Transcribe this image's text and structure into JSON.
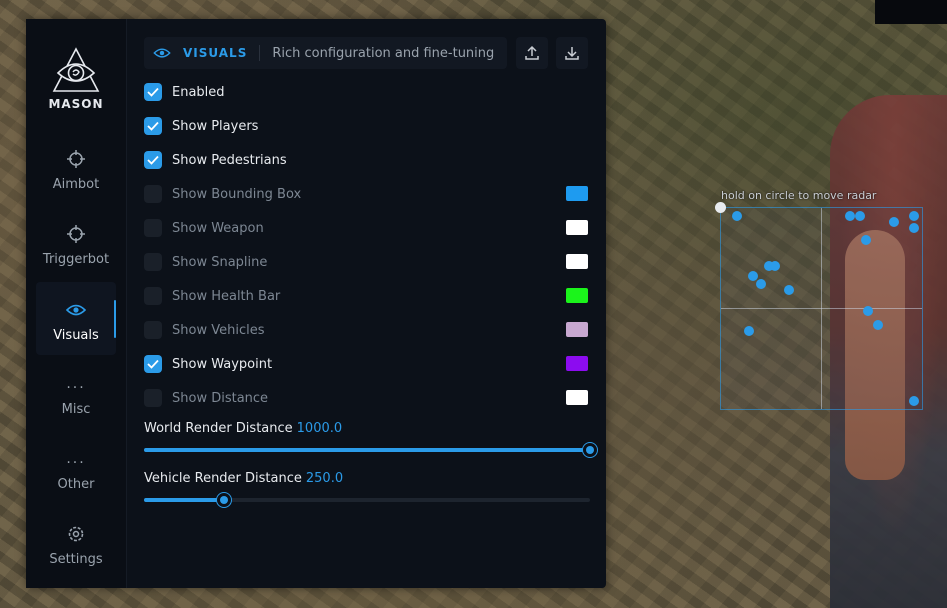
{
  "app": {
    "name": "MASON"
  },
  "nav": [
    {
      "label": "Aimbot",
      "icon": "crosshair-icon",
      "active": false
    },
    {
      "label": "Triggerbot",
      "icon": "crosshair-icon",
      "active": false
    },
    {
      "label": "Visuals",
      "icon": "eye-icon",
      "active": true
    },
    {
      "label": "Misc",
      "icon": "more-icon",
      "active": false
    },
    {
      "label": "Other",
      "icon": "more-icon",
      "active": false
    },
    {
      "label": "Settings",
      "icon": "gear-icon",
      "active": false
    }
  ],
  "header": {
    "title": "VISUALS",
    "subtitle": "Rich configuration and fine-tuning",
    "upload_icon": "upload-icon",
    "download_icon": "download-icon"
  },
  "options": [
    {
      "label": "Enabled",
      "checked": true,
      "color": null
    },
    {
      "label": "Show Players",
      "checked": true,
      "color": null
    },
    {
      "label": "Show Pedestrians",
      "checked": true,
      "color": null
    },
    {
      "label": "Show Bounding Box",
      "checked": false,
      "color": "#1e9bf0"
    },
    {
      "label": "Show Weapon",
      "checked": false,
      "color": "#ffffff"
    },
    {
      "label": "Show Snapline",
      "checked": false,
      "color": "#ffffff"
    },
    {
      "label": "Show Health Bar",
      "checked": false,
      "color": "#1bf41b"
    },
    {
      "label": "Show Vehicles",
      "checked": false,
      "color": "#c8a8d0"
    },
    {
      "label": "Show Waypoint",
      "checked": true,
      "color": "#8c0cf0"
    },
    {
      "label": "Show Distance",
      "checked": false,
      "color": "#ffffff"
    }
  ],
  "sliders": [
    {
      "label": "World Render Distance",
      "value": "1000.0",
      "fraction": 1.0
    },
    {
      "label": "Vehicle Render Distance",
      "value": "250.0",
      "fraction": 0.18
    }
  ],
  "radar": {
    "hint": "hold on circle to move radar",
    "blips": [
      [
        0.08,
        0.04
      ],
      [
        0.64,
        0.04
      ],
      [
        0.69,
        0.04
      ],
      [
        0.86,
        0.07
      ],
      [
        0.96,
        0.04
      ],
      [
        0.96,
        0.1
      ],
      [
        0.72,
        0.16
      ],
      [
        0.24,
        0.29
      ],
      [
        0.27,
        0.29
      ],
      [
        0.16,
        0.34
      ],
      [
        0.2,
        0.38
      ],
      [
        0.34,
        0.41
      ],
      [
        0.73,
        0.51
      ],
      [
        0.78,
        0.58
      ],
      [
        0.14,
        0.61
      ],
      [
        0.96,
        0.96
      ]
    ]
  },
  "colors": {
    "accent": "#2b9be8",
    "panel": "#0c1119"
  }
}
